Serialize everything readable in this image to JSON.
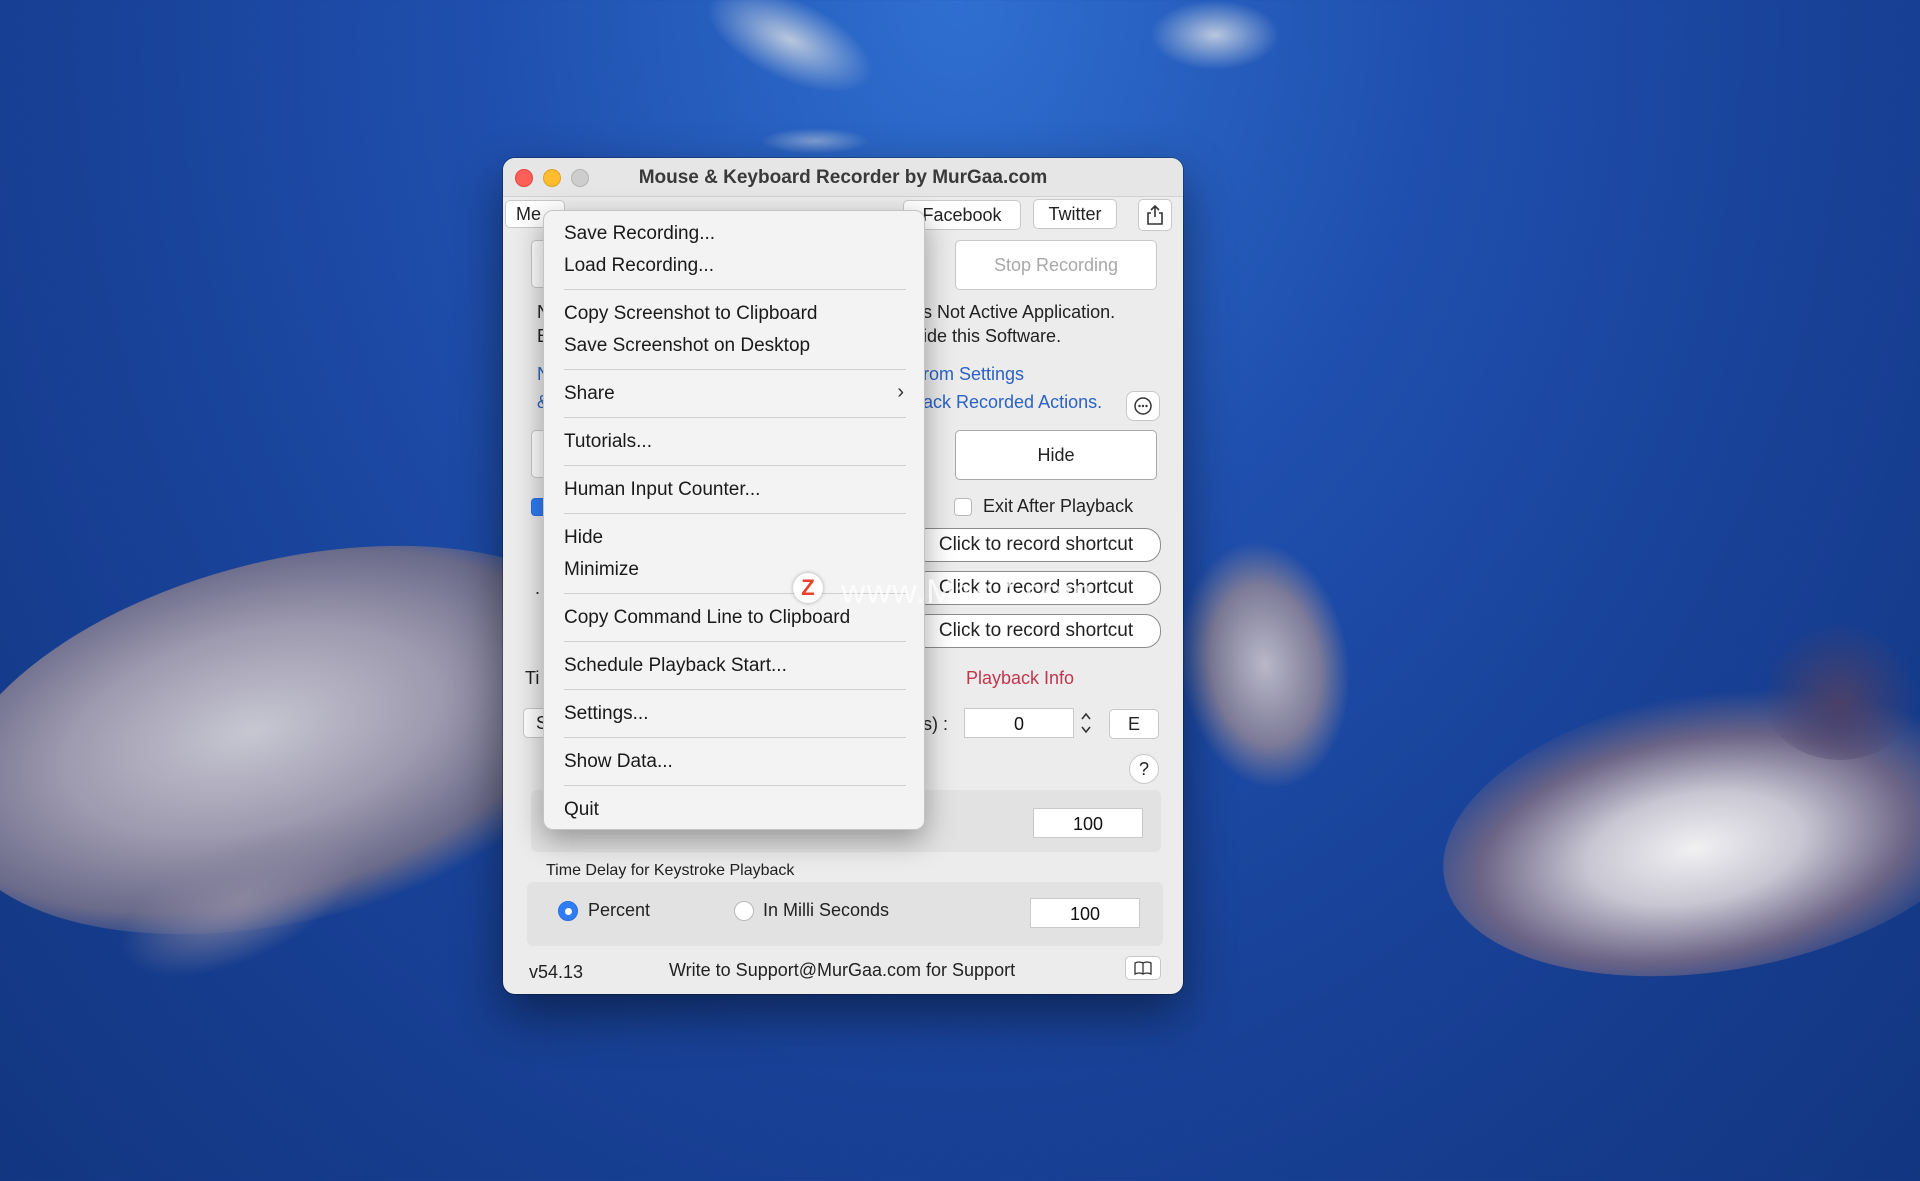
{
  "window": {
    "title": "Mouse & Keyboard Recorder by MurGaa.com"
  },
  "toolbar": {
    "menu_label": "Me",
    "facebook": "Facebook",
    "twitter": "Twitter",
    "stop_recording": "Stop Recording"
  },
  "main": {
    "status_line1": "s Not Active Application.",
    "status_line2": "ide this Software.",
    "link1": "rom Settings",
    "link2": "ack Recorded Actions.",
    "hide_button": "Hide",
    "exit_after_playback": "Exit After Playback",
    "shortcut1": "Click to record shortcut",
    "shortcut2": "Click to record shortcut",
    "shortcut3": "Click to record shortcut",
    "playback_info": "Playback Info",
    "stepper_label": "s) :",
    "stepper_value": "0",
    "e_button": "E",
    "help": "?",
    "mouse_delay_value": "100",
    "left_labels": [
      "N",
      "E",
      "N",
      "&",
      "Ti",
      "S"
    ],
    "left_dot": ".",
    "keystroke_title": "Time Delay for Keystroke Playback",
    "percent_label": "Percent",
    "ms_label": "In Milli Seconds",
    "keystroke_value": "100",
    "version": "v54.13",
    "support": "Write to Support@MurGaa.com for Support"
  },
  "menu": {
    "items": [
      "Save Recording...",
      "Load Recording...",
      "Copy Screenshot to Clipboard",
      "Save Screenshot on Desktop",
      "Share",
      "Tutorials...",
      "Human Input Counter...",
      "Hide",
      "Minimize",
      "Copy Command Line to Clipboard",
      "Schedule Playback Start...",
      "Settings...",
      "Show Data...",
      "Quit"
    ],
    "submenu_arrow": "›"
  },
  "watermark": {
    "badge": "Z",
    "text": "www.MacZ.com"
  },
  "colors": {
    "accent": "#2f7df6",
    "link": "#2b62c4",
    "playback_info": "#c0374f"
  }
}
